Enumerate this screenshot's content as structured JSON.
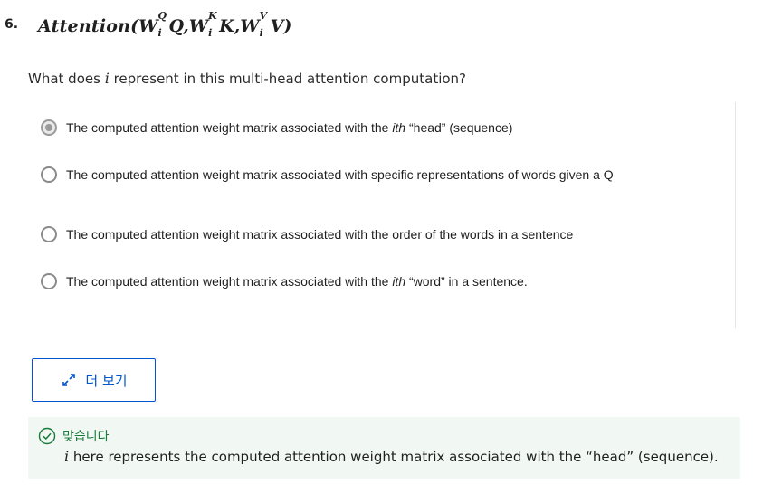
{
  "question": {
    "number": "6.",
    "formula": {
      "function": "Attention",
      "open": "(",
      "close": ")",
      "comma": ",",
      "terms": [
        {
          "w": "W",
          "sup": "Q",
          "sub": "i",
          "arg": "Q"
        },
        {
          "w": "W",
          "sup": "K",
          "sub": "i",
          "arg": "K"
        },
        {
          "w": "W",
          "sup": "V",
          "sub": "i",
          "arg": "V"
        }
      ]
    },
    "prompt_before": "What does ",
    "prompt_var": "i",
    "prompt_after": " represent in this multi-head attention computation?"
  },
  "options": [
    {
      "before": "The computed attention weight matrix associated with the ",
      "em": "ith",
      "after": " “head” (sequence)",
      "selected": true
    },
    {
      "before": "The computed attention weight matrix associated with specific representations of words given a Q",
      "em": "",
      "after": "",
      "selected": false
    },
    {
      "before": "The computed attention weight matrix associated with the order of the words in a sentence",
      "em": "",
      "after": "",
      "selected": false
    },
    {
      "before": "The computed attention weight matrix associated with the ",
      "em": "ith",
      "after": " “word” in a sentence.",
      "selected": false
    }
  ],
  "more_button": {
    "label": "더 보기",
    "icon": "expand-icon"
  },
  "feedback": {
    "status_icon": "check-circle-icon",
    "title": "맞습니다",
    "var": "i",
    "text": " here represents the computed attention weight matrix associated with the “head” (sequence).",
    "accent_color": "#1a7a3a",
    "background_color": "#f1f8f3"
  },
  "colors": {
    "link_blue": "#0056d2",
    "radio_border": "#8a8a8a"
  }
}
